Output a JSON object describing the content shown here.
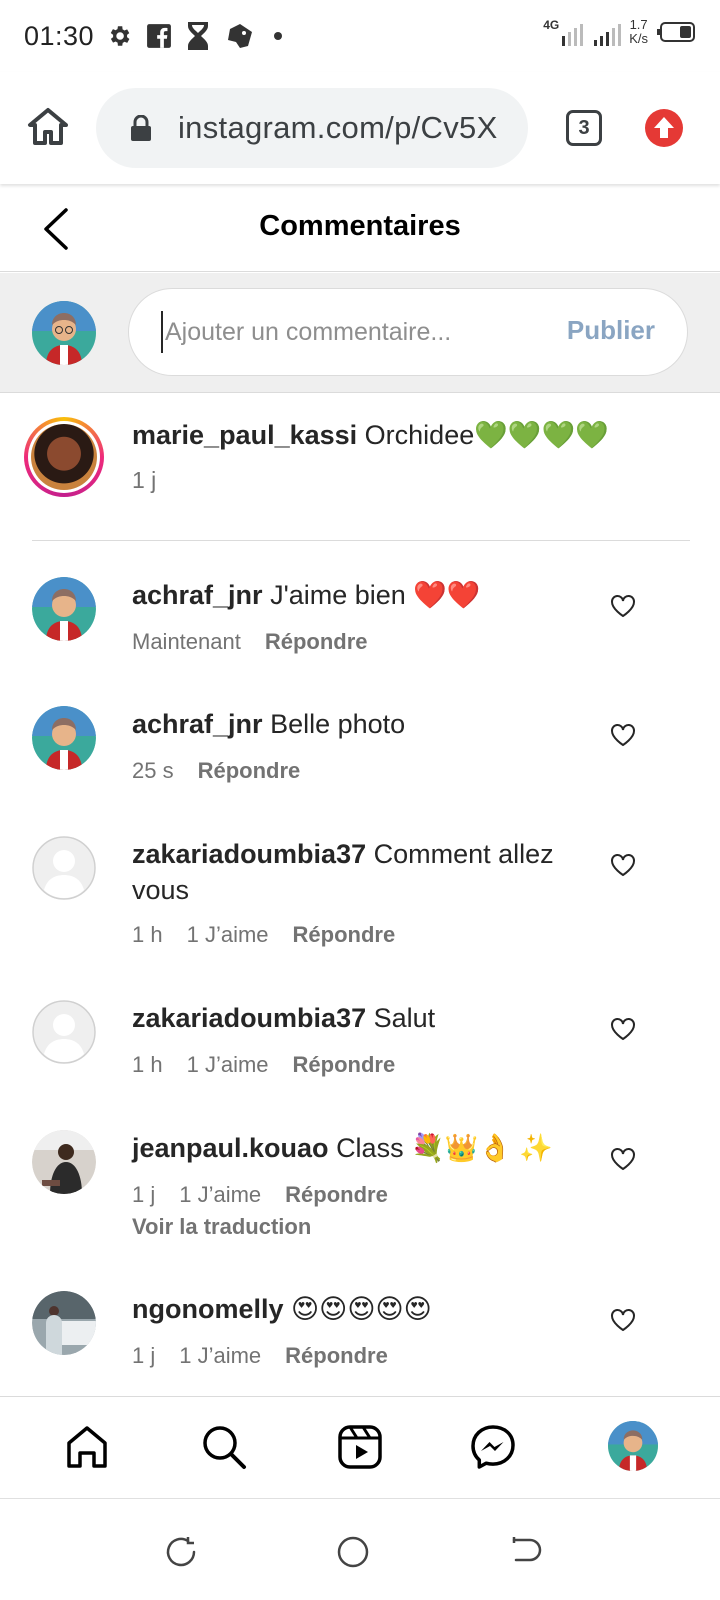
{
  "status_bar": {
    "time": "01:30",
    "signal_label": "4G",
    "speed_value": "1.7",
    "speed_unit": "K/s",
    "icons": [
      "gear-icon",
      "facebook-icon",
      "hourglass-icon",
      "game-icon",
      "dot-icon",
      "signal-icon",
      "battery-icon"
    ]
  },
  "browser": {
    "url": "instagram.com/p/Cv5X",
    "tab_count": "3"
  },
  "header": {
    "title": "Commentaires"
  },
  "composer": {
    "placeholder": "Ajouter un commentaire...",
    "publish_label": "Publier"
  },
  "caption": {
    "username": "marie_paul_kassi",
    "text": "Orchidee💚💚💚💚",
    "time": "1 j"
  },
  "comments": [
    {
      "username": "achraf_jnr",
      "text": "J'aime bien ❤️❤️",
      "time": "Maintenant",
      "likes": "",
      "reply_label": "Répondre"
    },
    {
      "username": "achraf_jnr",
      "text": "Belle photo",
      "time": "25 s",
      "likes": "",
      "reply_label": "Répondre"
    },
    {
      "username": "zakariadoumbia37",
      "text": "Comment allez vous",
      "time": "1 h",
      "likes": "1 J’aime",
      "reply_label": "Répondre"
    },
    {
      "username": "zakariadoumbia37",
      "text": "Salut",
      "time": "1 h",
      "likes": "1 J’aime",
      "reply_label": "Répondre"
    },
    {
      "username": "jeanpaul.kouao",
      "text": "Class 💐👑👌 ✨",
      "time": "1 j",
      "likes": "1 J’aime",
      "reply_label": "Répondre",
      "translate_label": "Voir la traduction"
    },
    {
      "username": "ngonomelly",
      "text": "😍😍😍😍😍",
      "time": "1 j",
      "likes": "1 J’aime",
      "reply_label": "Répondre"
    }
  ],
  "colors": {
    "publish_disabled": "#8aa5c2",
    "update_badge": "#e53935",
    "meta_grey": "#737373"
  }
}
